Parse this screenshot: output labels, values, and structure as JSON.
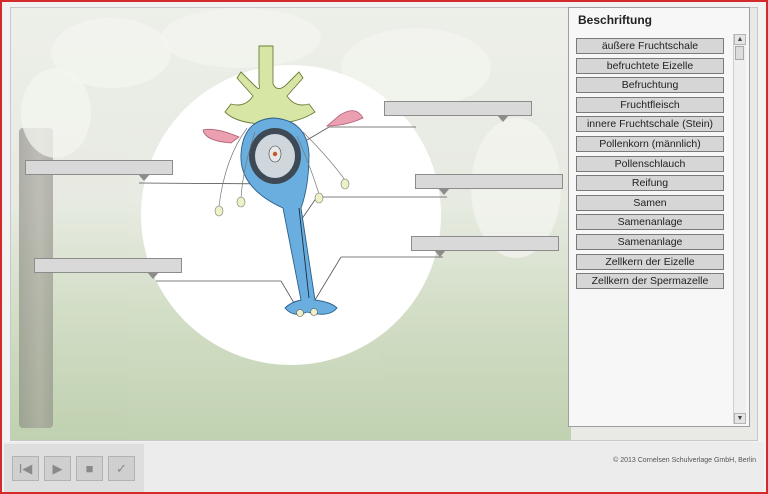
{
  "panel": {
    "title": "Beschriftung",
    "terms": [
      "äußere Fruchtschale",
      "befruchtete Eizelle",
      "Befruchtung",
      "Fruchtfleisch",
      "innere Fruchtschale (Stein)",
      "Pollenkorn (männlich)",
      "Pollenschlauch",
      "Reifung",
      "Samen",
      "Samenanlage",
      "Samenanlage",
      "Zellkern der Eizelle",
      "Zellkern der Spermazelle"
    ]
  },
  "scroll": {
    "up_glyph": "▲",
    "down_glyph": "▼"
  },
  "controls": {
    "first_glyph": "I◀",
    "play_glyph": "▶",
    "stop_glyph": "■",
    "check_glyph": "✓"
  },
  "footer": {
    "copyright": "© 2013 Cornelsen Schulverlage GmbH, Berlin"
  },
  "colors": {
    "frame_border": "#d42a2a",
    "ovary_blue": "#6aaee0",
    "petal_pink": "#eaa0b0",
    "stigma_green": "#d7e6a4"
  }
}
